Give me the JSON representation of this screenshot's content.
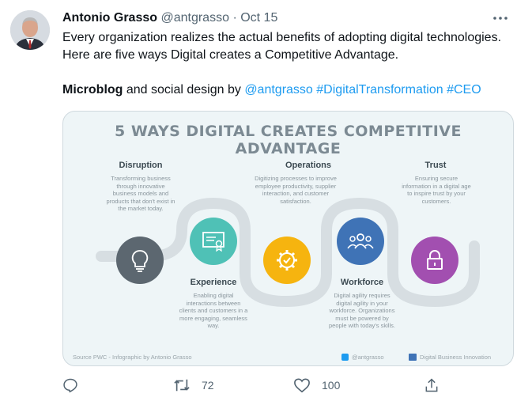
{
  "tweet": {
    "author_name": "Antonio Grasso",
    "handle": "@antgrasso",
    "separator": "·",
    "date": "Oct 15",
    "text_line1": "Every organization realizes the actual benefits of adopting digital technologies. Here are five ways Digital creates a Competitive Advantage.",
    "text_bold": "Microblog",
    "text_mid": " and social design by ",
    "mention": "@antgrasso",
    "hashtag1": "#DigitalTransformation",
    "hashtag2": "#CEO"
  },
  "infographic": {
    "title": "5 WAYS DIGITAL CREATES COMPETITIVE ADVANTAGE",
    "items": [
      {
        "title": "Disruption",
        "text": "Transforming business through innovative business models and products that don't exist in the market today.",
        "color": "#5c6770",
        "icon": "lightbulb-icon"
      },
      {
        "title": "Experience",
        "text": "Enabling digital interactions between clients and customers in a more engaging, seamless way.",
        "color": "#4fc1b6",
        "icon": "certificate-icon"
      },
      {
        "title": "Operations",
        "text": "Digitizing processes to improve employee productivity, supplier interaction, and customer satisfaction.",
        "color": "#f6b40f",
        "icon": "gear-check-icon"
      },
      {
        "title": "Workforce",
        "text": "Digital agility requires digital agility in your workforce. Organizations must be powered by people with today's skills.",
        "color": "#3f73b6",
        "icon": "people-icon"
      },
      {
        "title": "Trust",
        "text": "Ensuring secure information in a digital age to inspire trust by your customers.",
        "color": "#a24fb0",
        "icon": "padlock-icon"
      }
    ],
    "source": "Source PWC - Infographic by Antonio Grasso",
    "twitter_handle": "@antgrasso",
    "brand": "Digital Business Innovation"
  },
  "actions": {
    "retweets": "72",
    "likes": "100"
  },
  "colors": {
    "link": "#1d9bf0",
    "muted": "#536471"
  }
}
